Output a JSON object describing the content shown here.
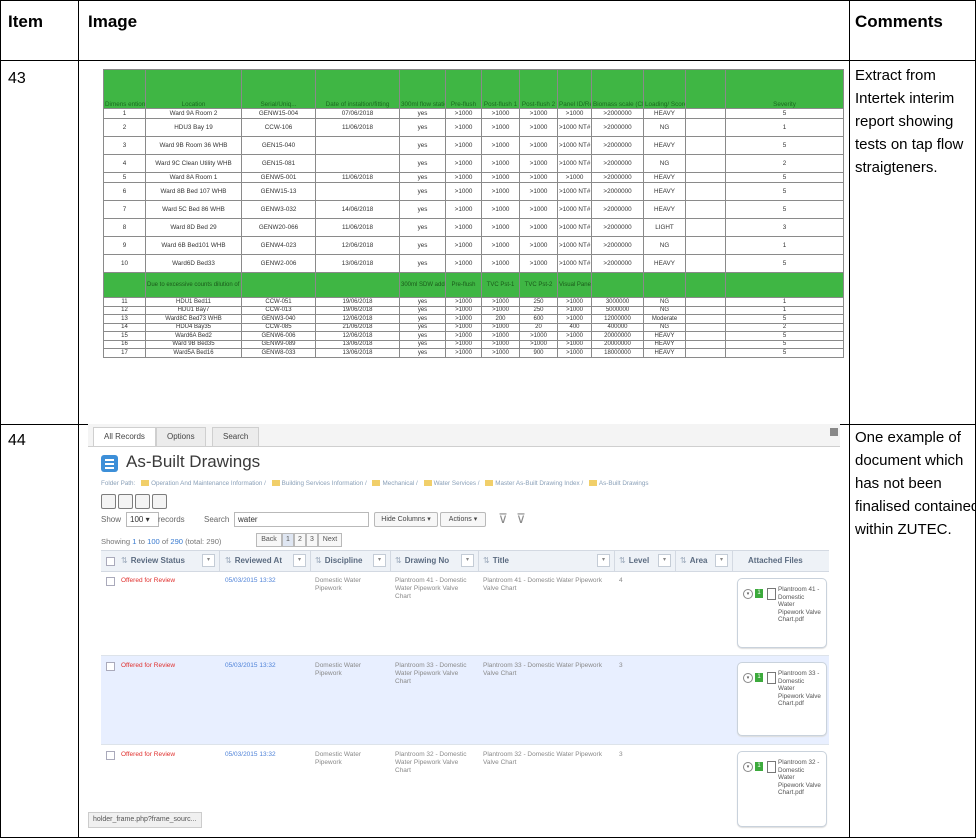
{
  "header": {
    "col_item": "Item",
    "col_image": "Image",
    "col_comments": "Comments"
  },
  "rows": [
    {
      "item": "43",
      "comment": "Extract from Intertek interim report showing tests on tap flow straigteners."
    },
    {
      "item": "44",
      "comment": "One example of document which has not been finalised contained within ZUTEC."
    }
  ],
  "sheet": {
    "header_row": [
      "Dimens ention",
      "Location",
      "Serial/Uniq...",
      "Date of instaltion/fitting",
      "300ml flow station",
      "Pre-flush",
      "Post-flush 1",
      "Post-flush 2",
      "Panel ID/Ref",
      "Biomass scale (CFU/ml prior flushing)",
      "Loading/ Score",
      "",
      "Severity"
    ],
    "rows_a": [
      [
        "1",
        "Ward 9A Room 2",
        "GENW15-004",
        "07/06/2018",
        "yes",
        ">1000",
        ">1000",
        ">1000",
        ">1000",
        ">2000000",
        "HEAVY",
        "",
        "5"
      ],
      [
        "2",
        "HDU3 Bay 19",
        "CCW-106",
        "11/06/2018",
        "yes",
        ">1000",
        ">1000",
        ">1000",
        ">1000 NT#",
        ">2000000",
        "NG",
        "",
        "1"
      ],
      [
        "3",
        "Ward 9B Room 36 WHB",
        "GEN15-040",
        "",
        "yes",
        ">1000",
        ">1000",
        ">1000",
        ">1000 NT#",
        ">2000000",
        "HEAVY",
        "",
        "5"
      ],
      [
        "4",
        "Ward 9C Clean Utility WHB",
        "GEN15-081",
        "",
        "yes",
        ">1000",
        ">1000",
        ">1000",
        ">1000 NT#",
        ">2000000",
        "NG",
        "",
        "2"
      ],
      [
        "5",
        "Ward 8A Room 1",
        "GENW5-001",
        "11/06/2018",
        "yes",
        ">1000",
        ">1000",
        ">1000",
        ">1000",
        ">2000000",
        "HEAVY",
        "",
        "5"
      ],
      [
        "6",
        "Ward 8B Bed 107 WHB",
        "GENW15-13",
        "",
        "yes",
        ">1000",
        ">1000",
        ">1000",
        ">1000 NT#",
        ">2000000",
        "HEAVY",
        "",
        "5"
      ],
      [
        "7",
        "Ward 5C Bed 86 WHB",
        "GENW3-032",
        "14/06/2018",
        "yes",
        ">1000",
        ">1000",
        ">1000",
        ">1000 NT#",
        ">2000000",
        "HEAVY",
        "",
        "5"
      ],
      [
        "8",
        "Ward 8D Bed 29",
        "GENW20-066",
        "11/06/2018",
        "yes",
        ">1000",
        ">1000",
        ">1000",
        ">1000 NT#",
        ">2000000",
        "LIGHT",
        "",
        "3"
      ],
      [
        "9",
        "Ward 6B Bed101 WHB",
        "GENW4-023",
        "12/06/2018",
        "yes",
        ">1000",
        ">1000",
        ">1000",
        ">1000 NT#",
        ">2000000",
        "NG",
        "",
        "1"
      ],
      [
        "10",
        "Ward6D Bed33",
        "GENW2-006",
        "13/06/2018",
        "yes",
        ">1000",
        ">1000",
        ">1000",
        ">1000 NT#",
        ">2000000",
        "HEAVY",
        "",
        "5"
      ]
    ],
    "mid_row": [
      "",
      "Due to excessive counts dilution of TVC changed",
      "",
      "",
      "300ml SDW added",
      "Pre-flush",
      "TVC Pst-1",
      "TVC Pst-2",
      "Visual Panel",
      "",
      "",
      "",
      ""
    ],
    "rows_b": [
      [
        "11",
        "HDU1 Bed11",
        "CCW-051",
        "19/06/2018",
        "yes",
        ">1000",
        ">1000",
        "250",
        ">1000",
        "3000000",
        "NG",
        "",
        "1"
      ],
      [
        "12",
        "HDU1 Bay7",
        "CCW-013",
        "19/06/2018",
        "yes",
        ">1000",
        ">1000",
        "250",
        ">1000",
        "5000000",
        "NG",
        "",
        "1"
      ],
      [
        "13",
        "Ward8C Bed73 WHB",
        "GENW3-040",
        "12/06/2018",
        "yes",
        ">1000",
        "200",
        "600",
        ">1000",
        "12000000",
        "Moderate",
        "",
        "5"
      ],
      [
        "14",
        "HDU4 Bay35",
        "CCW-085",
        "21/06/2018",
        "yes",
        ">1000",
        ">1000",
        "20",
        "400",
        "400000",
        "NG",
        "",
        "2"
      ],
      [
        "15",
        "Ward6A Bed2",
        "GENW6-006",
        "12/06/2018",
        "yes",
        ">1000",
        ">1000",
        ">1000",
        ">1000",
        "20000000",
        "HEAVY",
        "",
        "5"
      ],
      [
        "16",
        "Ward 9B Bed35",
        "GENW9-089",
        "13/06/2018",
        "yes",
        ">1000",
        ">1000",
        ">1000",
        ">1000",
        "20000000",
        "HEAVY",
        "",
        "5"
      ],
      [
        "17",
        "Ward5A Bed16",
        "GENW8-033",
        "13/06/2018",
        "yes",
        ">1000",
        ">1000",
        "900",
        ">1000",
        "18000000",
        "HEAVY",
        "",
        "5"
      ]
    ]
  },
  "app": {
    "tabs": [
      "All Records",
      "Options",
      "Search"
    ],
    "title": "As-Built Drawings",
    "folder_label": "Folder Path:",
    "folder_path": [
      "Operation And Maintenance Information /",
      "Building Services Information /",
      "Mechanical /",
      "Water Services /",
      "Master As-Built Drawing Index /",
      "As-Built Drawings"
    ],
    "show_label": "Show",
    "show_value": "100",
    "records_label": "records",
    "search_label": "Search",
    "search_value": "water",
    "hide_columns": "Hide Columns",
    "actions": "Actions",
    "showing_prefix": "Showing",
    "showing_from": "1",
    "showing_to_word": "to",
    "showing_to": "100",
    "showing_of_word": "of",
    "showing_of": "290",
    "showing_total": "(total: 290)",
    "pager": [
      "Back",
      "1",
      "2",
      "3",
      "Next"
    ],
    "columns": [
      "Review Status",
      "Reviewed At",
      "Discipline",
      "Drawing No",
      "Title",
      "Level",
      "Area",
      "Attached Files"
    ],
    "records": [
      {
        "status": "Offered for Review",
        "reviewed_at": "05/03/2015 13:32",
        "discipline": "Domestic Water Pipework",
        "drawing_no": "Plantroom 41 - Domestic Water Pipework Valve Chart",
        "title": "Plantroom 41 - Domestic Water Pipework Valve Chart",
        "level": "4",
        "area": "",
        "file_count": "1",
        "file": "Plantroom 41 - Domestic Water Pipework Valve Chart.pdf"
      },
      {
        "status": "Offered for Review",
        "reviewed_at": "05/03/2015 13:32",
        "discipline": "Domestic Water Pipework",
        "drawing_no": "Plantroom 33 - Domestic Water Pipework Valve Chart",
        "title": "Plantroom 33 - Domestic Water Pipework Valve Chart",
        "level": "3",
        "area": "",
        "file_count": "1",
        "file": "Plantroom 33 - Domestic Water Pipework Valve Chart.pdf"
      },
      {
        "status": "Offered for Review",
        "reviewed_at": "05/03/2015 13:32",
        "discipline": "Domestic Water Pipework",
        "drawing_no": "Plantroom 32 - Domestic Water Pipework Valve Chart",
        "title": "Plantroom 32 - Domestic Water Pipework Valve Chart",
        "level": "3",
        "area": "",
        "file_count": "1",
        "file": "Plantroom 32 - Domestic Water Pipework Valve Chart.pdf"
      }
    ],
    "status_bar": "holder_frame.php?frame_sourc..."
  },
  "colors": {
    "sheet_green": "#3fb644",
    "status_red": "#e0302e",
    "link_blue": "#4e82d8",
    "title_icon": "#3d8fd8"
  }
}
